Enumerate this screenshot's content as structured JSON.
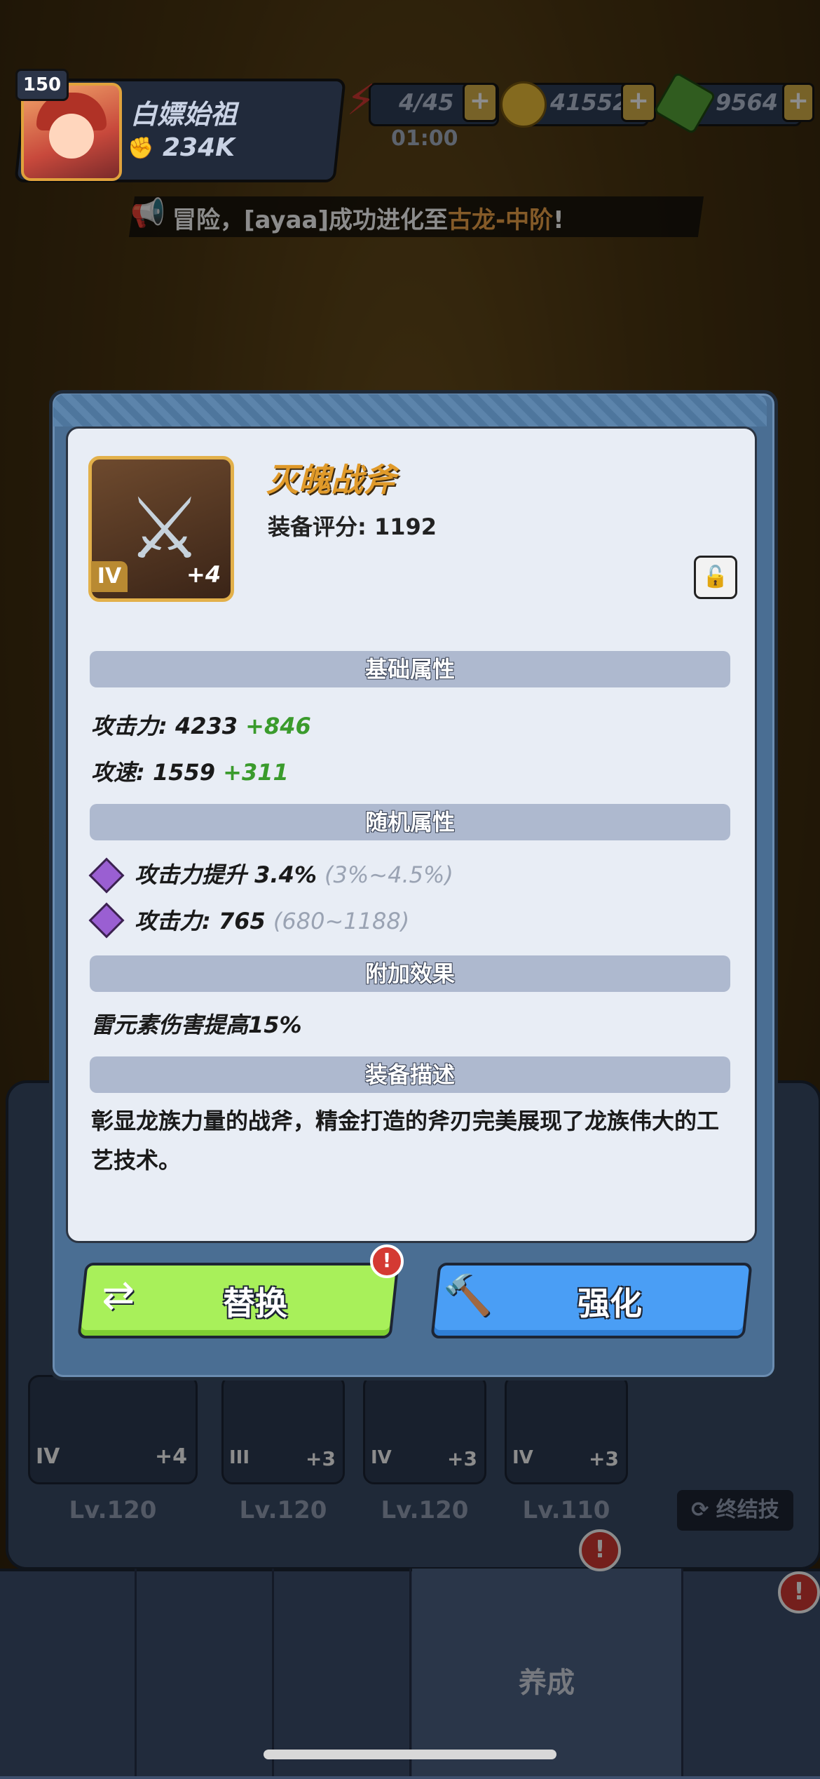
{
  "header": {
    "level": "150",
    "player_name": "白嫖始祖",
    "power": "234K",
    "stamina": "4/45",
    "stamina_timer": "01:00",
    "gold": "41552",
    "gems": "9564",
    "plus_label": "+"
  },
  "broadcast": {
    "prefix": "冒险，[ayaa]成功进化至",
    "highlight": "古龙-中阶",
    "suffix": "!"
  },
  "item": {
    "name": "灭魄战斧",
    "score_label": "装备评分: 1192",
    "tier": "IV",
    "enhance": "+4",
    "lock_icon": "🔓"
  },
  "sections": {
    "base": "基础属性",
    "random": "随机属性",
    "extra": "附加效果",
    "description": "装备描述"
  },
  "base_stats": [
    {
      "label": "攻击力:",
      "value": "4233",
      "bonus": "+846"
    },
    {
      "label": "攻速:",
      "value": "1559",
      "bonus": "+311"
    }
  ],
  "random_stats": [
    {
      "label": "攻击力提升 3.4%",
      "range": "(3%~4.5%)"
    },
    {
      "label": "攻击力: 765",
      "range": "(680~1188)"
    }
  ],
  "extra_effect": "雷元素伤害提高15%",
  "description": "彰显龙族力量的战斧，精金打造的斧刃完美展现了龙族伟大的工艺技术。",
  "buttons": {
    "replace": "替换",
    "enhance": "强化",
    "replace_badge": "!"
  },
  "background": {
    "slots": [
      {
        "tier": "IV",
        "plus": "+4",
        "level": "Lv.120"
      },
      {
        "tier": "III",
        "plus": "+3",
        "level": "Lv.120"
      },
      {
        "tier": "IV",
        "plus": "+3",
        "level": "Lv.120"
      },
      {
        "tier": "IV",
        "plus": "+3",
        "level": "Lv.110"
      }
    ],
    "ultimate": "终结技",
    "nav_active_label": "养成",
    "badge": "!"
  },
  "colors": {
    "name_orange": "#e09a2a",
    "bonus_green": "#3a9b2c",
    "replace_green": "#a8f05a",
    "enhance_blue": "#4a9ef5"
  }
}
